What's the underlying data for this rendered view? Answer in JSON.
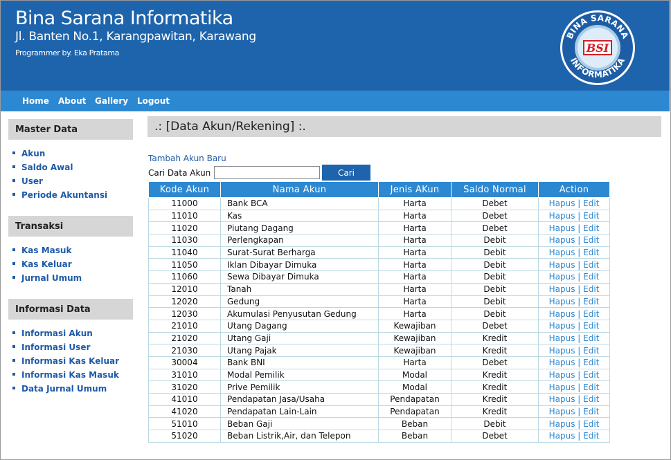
{
  "header": {
    "title": "Bina Sarana Informatika",
    "address": "Jl. Banten No.1, Karangpawitan, Karawang",
    "programmer": "Programmer by. Eka Pratama",
    "logo_text_top": "BINA SARANA",
    "logo_text_bottom": "INFORMATIKA",
    "logo_mark": "BSI"
  },
  "nav": [
    "Home",
    "About",
    "Gallery",
    "Logout"
  ],
  "sidebar": {
    "sections": [
      {
        "title": "Master Data",
        "items": [
          "Akun",
          "Saldo Awal",
          "User",
          "Periode Akuntansi"
        ]
      },
      {
        "title": "Transaksi",
        "items": [
          "Kas Masuk",
          "Kas Keluar",
          "Jurnal Umum"
        ]
      },
      {
        "title": "Informasi Data",
        "items": [
          "Informasi Akun",
          "Informasi User",
          "Informasi Kas Keluar",
          "Informasi Kas Masuk",
          "Data Jurnal Umum"
        ]
      }
    ]
  },
  "main": {
    "heading": ".: [Data Akun/Rekening] :.",
    "add_link": "Tambah Akun Baru",
    "search_label": "Cari Data Akun :",
    "search_value": "",
    "search_button": "Cari",
    "table": {
      "columns": [
        "Kode Akun",
        "Nama Akun",
        "Jenis AKun",
        "Saldo Normal",
        "Action"
      ],
      "rows": [
        [
          "11000",
          "Bank BCA",
          "Harta",
          "Debet"
        ],
        [
          "11010",
          "Kas",
          "Harta",
          "Debet"
        ],
        [
          "11020",
          "Piutang Dagang",
          "Harta",
          "Debet"
        ],
        [
          "11030",
          "Perlengkapan",
          "Harta",
          "Debit"
        ],
        [
          "11040",
          "Surat-Surat Berharga",
          "Harta",
          "Debit"
        ],
        [
          "11050",
          "Iklan Dibayar Dimuka",
          "Harta",
          "Debit"
        ],
        [
          "11060",
          "Sewa Dibayar Dimuka",
          "Harta",
          "Debit"
        ],
        [
          "12010",
          "Tanah",
          "Harta",
          "Debit"
        ],
        [
          "12020",
          "Gedung",
          "Harta",
          "Debit"
        ],
        [
          "12030",
          "Akumulasi Penyusutan Gedung",
          "Harta",
          "Debit"
        ],
        [
          "21010",
          "Utang Dagang",
          "Kewajiban",
          "Debet"
        ],
        [
          "21020",
          "Utang Gaji",
          "Kewajiban",
          "Kredit"
        ],
        [
          "21030",
          "Utang Pajak",
          "Kewajiban",
          "Kredit"
        ],
        [
          "30004",
          "Bank BNI",
          "Harta",
          "Debet"
        ],
        [
          "31010",
          "Modal Pemilik",
          "Modal",
          "Kredit"
        ],
        [
          "31020",
          "Prive Pemilik",
          "Modal",
          "Kredit"
        ],
        [
          "41010",
          "Pendapatan Jasa/Usaha",
          "Pendapatan",
          "Kredit"
        ],
        [
          "41020",
          "Pendapatan Lain-Lain",
          "Pendapatan",
          "Kredit"
        ],
        [
          "51010",
          "Beban Gaji",
          "Beban",
          "Debit"
        ],
        [
          "51020",
          "Beban Listrik,Air, dan Telepon",
          "Beban",
          "Debet"
        ]
      ],
      "action_delete": "Hapus",
      "action_separator": "|",
      "action_edit": "Edit"
    }
  },
  "colors": {
    "header_bg": "#1e64ac",
    "nav_bg": "#2d88d2",
    "link": "#1e5aa8",
    "sidebar_head": "#d6d6d6"
  }
}
